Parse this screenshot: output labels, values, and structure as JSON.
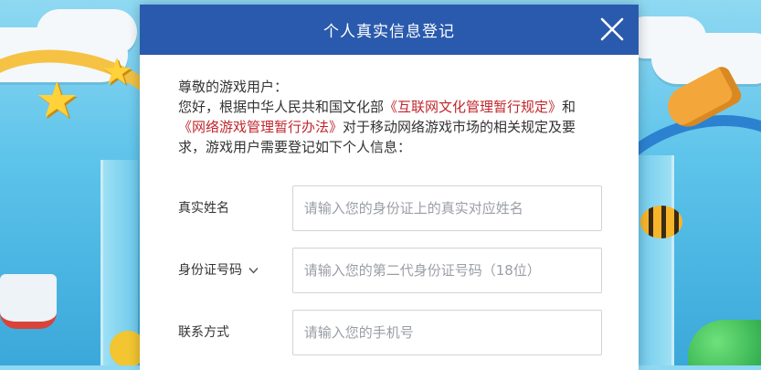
{
  "colors": {
    "header_bg": "#2a5aad",
    "law_text": "#c1272d"
  },
  "dialog": {
    "title": "个人真实信息登记",
    "close_icon": "close-icon"
  },
  "notice": {
    "greeting": "尊敬的游戏用户：",
    "line1_prefix": "您好，根据中华人民共和国文化部",
    "law1": "《互联网文化管理暂行规定》",
    "and": "和",
    "law2": "《网络游戏管理暂行办法》",
    "suffix": "对于移动网络游戏市场的相关规定及要求，游戏用户需要登记如下个人信息："
  },
  "form": {
    "name": {
      "label": "真实姓名",
      "placeholder": "请输入您的身份证上的真实对应姓名",
      "value": ""
    },
    "id_type": {
      "label": "身份证号码",
      "caret_icon": "chevron-down-icon",
      "placeholder": "请输入您的第二代身份证号码（18位）",
      "value": ""
    },
    "contact": {
      "label": "联系方式",
      "placeholder": "请输入您的手机号",
      "value": ""
    }
  }
}
